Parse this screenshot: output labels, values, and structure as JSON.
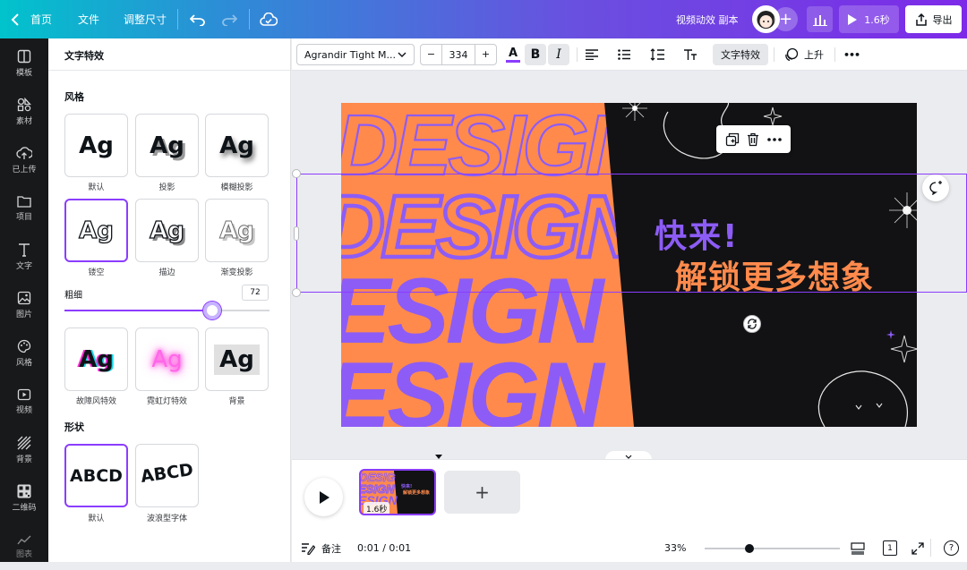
{
  "topbar": {
    "home": "首页",
    "file": "文件",
    "resize": "调整尺寸",
    "doc_title": "视频动效 副本",
    "play_label": "1.6秒",
    "export": "导出",
    "accent": "#8b3dff"
  },
  "rail": {
    "items": [
      {
        "label": "模板",
        "icon": "template-icon"
      },
      {
        "label": "素材",
        "icon": "elements-icon"
      },
      {
        "label": "已上传",
        "icon": "upload-icon"
      },
      {
        "label": "项目",
        "icon": "folder-icon"
      },
      {
        "label": "文字",
        "icon": "text-icon"
      },
      {
        "label": "图片",
        "icon": "image-icon"
      },
      {
        "label": "风格",
        "icon": "palette-icon"
      },
      {
        "label": "视频",
        "icon": "video-icon"
      },
      {
        "label": "背景",
        "icon": "background-icon"
      },
      {
        "label": "二维码",
        "icon": "qrcode-icon"
      },
      {
        "label": "图表",
        "icon": "chart-icon"
      }
    ]
  },
  "panel": {
    "title": "文字特效",
    "style_heading": "风格",
    "styles": [
      {
        "sample": "Ag",
        "label": "默认"
      },
      {
        "sample": "Ag",
        "label": "投影"
      },
      {
        "sample": "Ag",
        "label": "模糊投影"
      },
      {
        "sample": "Ag",
        "label": "镂空"
      },
      {
        "sample": "Ag",
        "label": "描边"
      },
      {
        "sample": "Ag",
        "label": "渐变投影"
      },
      {
        "sample": "Ag",
        "label": "故障风特效"
      },
      {
        "sample": "Ag",
        "label": "霓虹灯特效"
      },
      {
        "sample": "Ag",
        "label": "背景"
      }
    ],
    "thickness_label": "粗细",
    "thickness_value": "72",
    "thickness_level": 0.72,
    "shape_heading": "形状",
    "shapes": [
      {
        "sample": "ABCD",
        "label": "默认"
      },
      {
        "sample": "ABCD",
        "label": "波浪型字体"
      }
    ]
  },
  "toolbar": {
    "font": "Agrandir Tight M...",
    "minus": "−",
    "size": "334",
    "plus": "+",
    "color_letter": "A",
    "bold": "B",
    "italic": "I",
    "effects": "文字特效",
    "animate": "上升",
    "more": "•••"
  },
  "canvas": {
    "bg_words": [
      "DESIGN",
      "DESIGN",
      "ESIGN",
      "ESIGN"
    ],
    "line1": "快来!",
    "line2": "解锁更多想象",
    "orange": "#ff8a4c",
    "purple": "#8d5cf6"
  },
  "timeline": {
    "thumb_duration": "1.6秒",
    "thumb_line1": "快来!",
    "thumb_line2": "解锁更多想象",
    "add": "+",
    "notes": "备注",
    "time": "0:01 / 0:01",
    "zoom": "33%",
    "zoom_level": 0.33,
    "page": "1",
    "help": "?"
  }
}
